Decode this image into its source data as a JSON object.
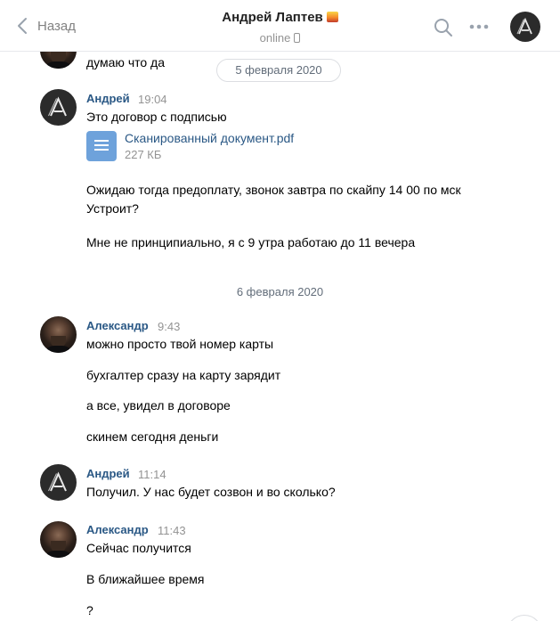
{
  "header": {
    "back_label": "Назад",
    "title": "Андрей Лаптев",
    "status": "online",
    "icons": [
      "chevron-left-icon",
      "search-icon",
      "more-icon",
      "avatar"
    ]
  },
  "chat": {
    "partial_message": "думаю что да",
    "date_1": "5 февраля 2020",
    "date_2": "6 февраля 2020",
    "groups": [
      {
        "sender": "Андрей",
        "time": "19:04",
        "messages": [
          "Это договор с подписью",
          "Ожидаю тогда предоплату, звонок завтра по скайпу 14 00 по мск Устроит?",
          "Мне не принципиально, я с 9 утра работаю до 11 вечера"
        ],
        "attachment": {
          "name": "Сканированный документ.pdf",
          "size": "227 КБ",
          "icon": "document-icon"
        }
      },
      {
        "sender": "Александр",
        "time": "9:43",
        "messages": [
          "можно просто твой номер карты",
          "бухгалтер сразу на карту зарядит",
          "а все, увидел в договоре",
          "скинем сегодня деньги"
        ]
      },
      {
        "sender": "Андрей",
        "time": "11:14",
        "messages": [
          "Получил. У нас будет созвон и во сколько?"
        ]
      },
      {
        "sender": "Александр",
        "time": "11:43",
        "messages": [
          "Сейчас получится",
          "В ближайшее время",
          "?"
        ]
      }
    ]
  },
  "colors": {
    "link": "#2a5885",
    "muted": "#939393",
    "doc_icon": "#6ea2db",
    "avatar_bg": "#2b2b2b"
  }
}
